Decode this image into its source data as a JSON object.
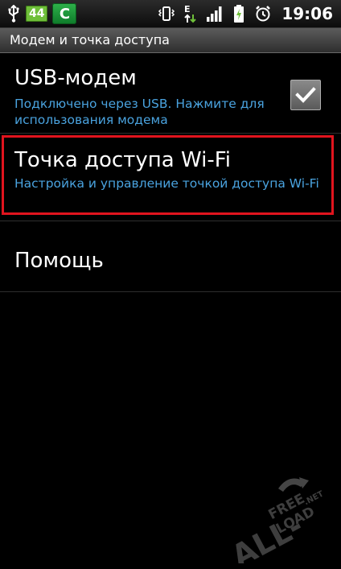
{
  "status_bar": {
    "badge": "44",
    "app_icon_letter": "C",
    "network_letter": "E",
    "time": "19:06",
    "icons": [
      "usb-icon",
      "network-badge-icon",
      "app-c-icon",
      "vibrate-icon",
      "data-e-icon",
      "signal-icon",
      "battery-charging-icon",
      "alarm-icon"
    ]
  },
  "title_bar": {
    "title": "Модем и точка доступа"
  },
  "list": {
    "usb": {
      "title": "USB-модем",
      "summary": "Подключено через USB. Нажмите для использования модема",
      "checked": true
    },
    "wifi": {
      "title": "Точка доступа Wi-Fi",
      "summary": "Настройка и управление точкой доступа Wi-Fi"
    },
    "help": {
      "title": "Помощь"
    }
  },
  "colors": {
    "highlight_border": "#e1141e",
    "summary_text": "#4aa3df",
    "badge_green": "#6fbf3a"
  },
  "watermark": {
    "line1": "ALL-",
    "line2": "FREE",
    "line3": "LOAD",
    "suffix": ".NET"
  }
}
